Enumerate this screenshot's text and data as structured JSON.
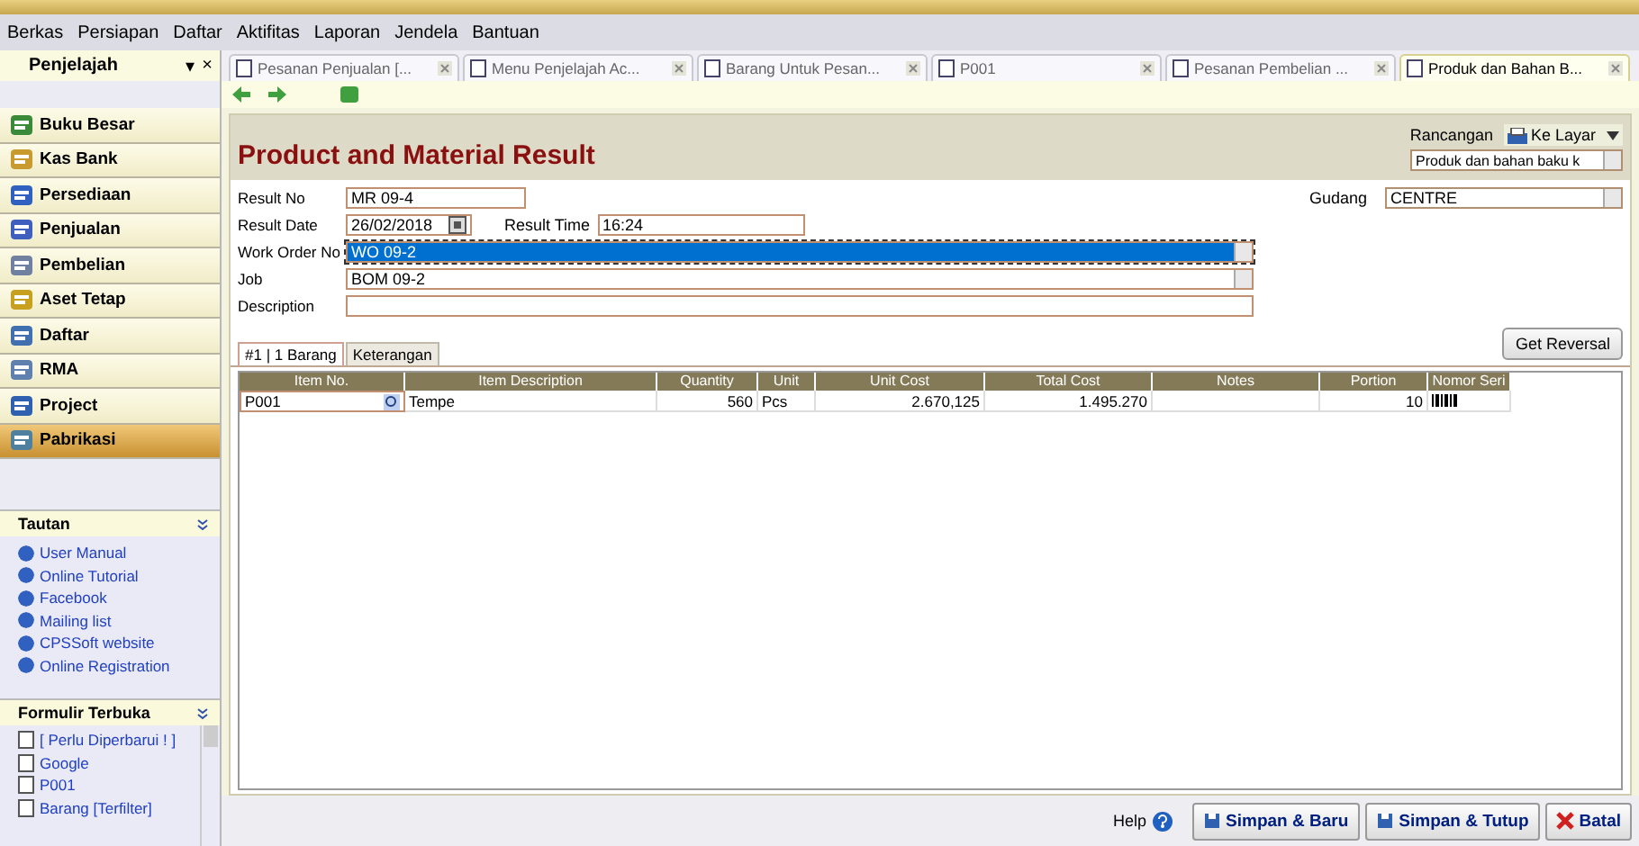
{
  "menu": [
    "Berkas",
    "Persiapan",
    "Daftar",
    "Aktifitas",
    "Laporan",
    "Jendela",
    "Bantuan"
  ],
  "sidebar": {
    "title": "Penjelajah",
    "pin": "▾",
    "close": "×",
    "items": [
      {
        "label": "Buku Besar",
        "selected": false
      },
      {
        "label": "Kas Bank",
        "selected": false
      },
      {
        "label": "Persediaan",
        "selected": false
      },
      {
        "label": "Penjualan",
        "selected": false
      },
      {
        "label": "Pembelian",
        "selected": false
      },
      {
        "label": "Aset Tetap",
        "selected": false
      },
      {
        "label": "Daftar",
        "selected": false
      },
      {
        "label": "RMA",
        "selected": false
      },
      {
        "label": "Project",
        "selected": false
      },
      {
        "label": "Pabrikasi",
        "selected": true
      }
    ],
    "links_panel": {
      "title": "Tautan",
      "items": [
        "User Manual",
        "Online Tutorial",
        "Facebook",
        "Mailing list",
        "CPSSoft website",
        "Online Registration"
      ]
    },
    "open_forms_panel": {
      "title": "Formulir Terbuka",
      "items": [
        "[ Perlu Diperbarui ! ]",
        "Google",
        "P001",
        "Barang [Terfilter]"
      ]
    }
  },
  "doc_tabs": [
    {
      "label": "Pesanan Penjualan [...",
      "selected": false
    },
    {
      "label": "Menu Penjelajah Ac...",
      "selected": false
    },
    {
      "label": "Barang Untuk Pesan...",
      "selected": false
    },
    {
      "label": "P001",
      "selected": false
    },
    {
      "label": "Pesanan Pembelian ...",
      "selected": false
    },
    {
      "label": "Produk dan Bahan B...",
      "selected": true
    }
  ],
  "form": {
    "title": "Product and Material Result",
    "design": {
      "label": "Rancangan",
      "output": "Ke Layar",
      "template": "Produk dan bahan baku k"
    },
    "warehouse": {
      "label": "Gudang",
      "value": "CENTRE"
    },
    "fields": [
      {
        "label": "Result No",
        "value": "MR 09-4",
        "kind": "short",
        "focused": false
      },
      {
        "label": "Result Date",
        "value": "26/02/2018",
        "kind": "date",
        "focused": false,
        "extra_label": "Result Time",
        "extra_value": "16:24"
      },
      {
        "label": "Work Order No",
        "value": "WO 09-2",
        "kind": "dropdown",
        "focused": true
      },
      {
        "label": "Job",
        "value": "BOM 09-2",
        "kind": "dropdown",
        "focused": false
      },
      {
        "label": "Description",
        "kind": "wide",
        "focused": false
      }
    ],
    "tabs": [
      {
        "label": "#1 | 1 Barang",
        "selected": true
      },
      {
        "label": "Keterangan",
        "selected": false
      }
    ],
    "reversal_button": "Get Reversal",
    "table": {
      "columns": [
        "Item No.",
        "Item Description",
        "Quantity",
        "Unit",
        "Unit Cost",
        "Total Cost",
        "Notes",
        "Portion",
        "Nomor Seri"
      ],
      "rows": [
        {
          "item_no": "P001",
          "description": "Tempe",
          "quantity": "560",
          "unit": "Pcs",
          "unit_cost": "2.670,125",
          "total_cost": "1.495.270",
          "portion": "10"
        }
      ]
    }
  },
  "footer": {
    "help": "Help",
    "buttons": [
      "Simpan & Baru",
      "Simpan & Tutup",
      "Batal"
    ]
  }
}
